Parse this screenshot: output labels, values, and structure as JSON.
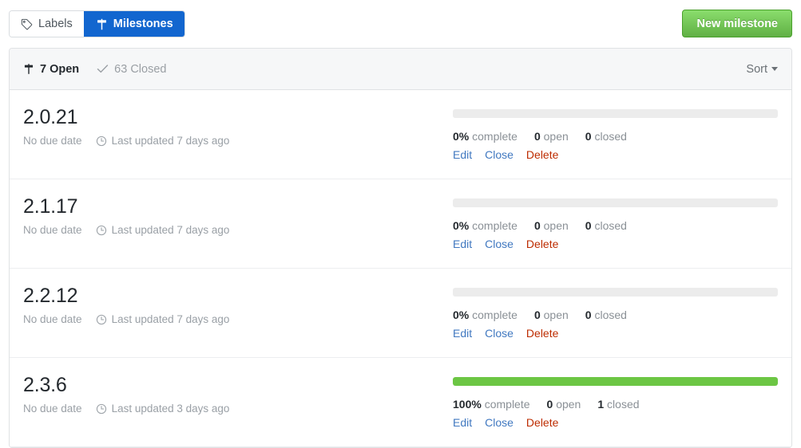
{
  "tabs": [
    {
      "label": "Labels",
      "icon": "tag-icon",
      "selected": false
    },
    {
      "label": "Milestones",
      "icon": "milestone-icon",
      "selected": true
    }
  ],
  "new_milestone_button": {
    "label": "New milestone",
    "color": "#60b044"
  },
  "list_header": {
    "open": {
      "count": 7,
      "label": "7 Open",
      "icon": "milestone-icon",
      "active": true
    },
    "closed": {
      "count": 63,
      "label": "63 Closed",
      "icon": "check-icon",
      "active": false
    },
    "sort": {
      "label": "Sort",
      "icon": "caret-down-icon"
    }
  },
  "colors": {
    "accent_blue": "#4078c0",
    "danger_red": "#bd2c00",
    "progress_green": "#6cc644",
    "tab_blue": "#1266cf",
    "track_gray": "#ececec"
  },
  "labels": {
    "complete": "complete",
    "open": "open",
    "closed": "closed",
    "edit": "Edit",
    "close": "Close",
    "delete": "Delete"
  },
  "milestones": [
    {
      "title": "2.0.21",
      "due": "No due date",
      "updated": "Last updated 7 days ago",
      "percent": 0,
      "percent_label": "0%",
      "open": 0,
      "closed": 0
    },
    {
      "title": "2.1.17",
      "due": "No due date",
      "updated": "Last updated 7 days ago",
      "percent": 0,
      "percent_label": "0%",
      "open": 0,
      "closed": 0
    },
    {
      "title": "2.2.12",
      "due": "No due date",
      "updated": "Last updated 7 days ago",
      "percent": 0,
      "percent_label": "0%",
      "open": 0,
      "closed": 0
    },
    {
      "title": "2.3.6",
      "due": "No due date",
      "updated": "Last updated 3 days ago",
      "percent": 100,
      "percent_label": "100%",
      "open": 0,
      "closed": 1
    }
  ]
}
